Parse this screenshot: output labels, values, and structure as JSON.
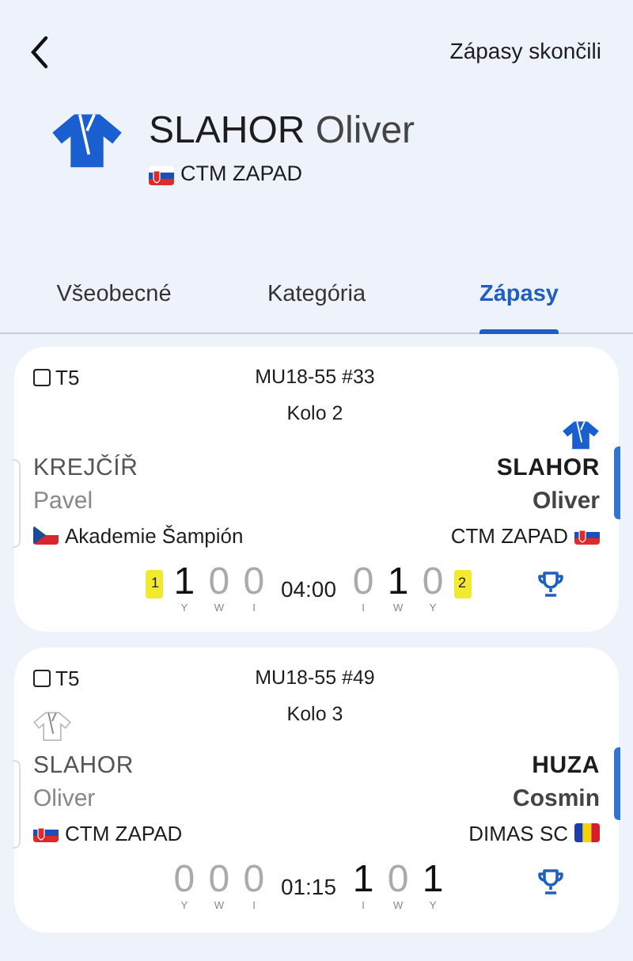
{
  "header": {
    "status": "Zápasy skončili"
  },
  "profile": {
    "surname": "SLAHOR",
    "given_name": "Oliver",
    "club": "CTM ZAPAD",
    "flag": {
      "kind": "sk"
    }
  },
  "tabs": [
    {
      "label": "Všeobecné",
      "selected": false
    },
    {
      "label": "Kategória",
      "selected": false
    },
    {
      "label": "Zápasy",
      "selected": true
    }
  ],
  "matches": [
    {
      "tatami": "T5",
      "category": "MU18-55 #33",
      "round": "Kolo 2",
      "left": {
        "surname": "KREJČÍŘ",
        "given_name": "Pavel",
        "club": "Akademie Šampión",
        "flag": {
          "kind": "cz"
        },
        "winner": false,
        "judogi_icon": false,
        "penalty": "1",
        "scores": [
          {
            "value": "1",
            "label": "Y",
            "lit": true
          },
          {
            "value": "0",
            "label": "W",
            "lit": false
          },
          {
            "value": "0",
            "label": "I",
            "lit": false
          }
        ]
      },
      "time": "04:00",
      "right": {
        "surname": "SLAHOR",
        "given_name": "Oliver",
        "club": "CTM ZAPAD",
        "flag": {
          "kind": "sk"
        },
        "winner": true,
        "judogi_icon": true,
        "penalty": "2",
        "scores": [
          {
            "value": "0",
            "label": "I",
            "lit": false
          },
          {
            "value": "1",
            "label": "W",
            "lit": true
          },
          {
            "value": "0",
            "label": "Y",
            "lit": false
          }
        ]
      }
    },
    {
      "tatami": "T5",
      "category": "MU18-55 #49",
      "round": "Kolo 3",
      "left": {
        "surname": "SLAHOR",
        "given_name": "Oliver",
        "club": "CTM ZAPAD",
        "flag": {
          "kind": "sk"
        },
        "winner": false,
        "judogi_icon": true,
        "scores": [
          {
            "value": "0",
            "label": "Y",
            "lit": false
          },
          {
            "value": "0",
            "label": "W",
            "lit": false
          },
          {
            "value": "0",
            "label": "I",
            "lit": false
          }
        ]
      },
      "time": "01:15",
      "right": {
        "surname": "HUZA",
        "given_name": "Cosmin",
        "club": "DIMAS SC",
        "flag": {
          "kind": "ro"
        },
        "winner": true,
        "judogi_icon": false,
        "scores": [
          {
            "value": "1",
            "label": "I",
            "lit": true
          },
          {
            "value": "0",
            "label": "W",
            "lit": false
          },
          {
            "value": "1",
            "label": "Y",
            "lit": true
          }
        ]
      }
    }
  ]
}
